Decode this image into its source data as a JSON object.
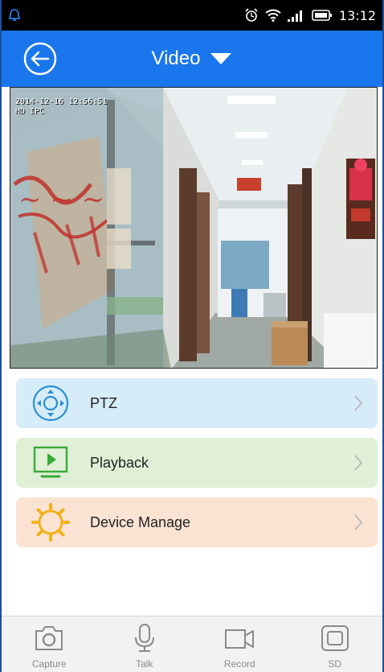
{
  "status_bar": {
    "time": "13:12",
    "icons": [
      "qq-bell-icon",
      "alarm-clock-icon",
      "wifi-icon",
      "signal-icon",
      "battery-icon"
    ]
  },
  "header": {
    "title": "Video",
    "back_icon": "back-arrow-icon",
    "dropdown_icon": "triangle-down-icon",
    "background_color": "#1a76ec"
  },
  "video": {
    "osd_datetime": "2014-12-16 12:56:51",
    "osd_camera": "HD IPC"
  },
  "menu": {
    "items": [
      {
        "label": "PTZ",
        "icon": "ptz-joystick-icon",
        "bg": "#d6ecf8"
      },
      {
        "label": "Playback",
        "icon": "playback-monitor-icon",
        "bg": "#dff0d6"
      },
      {
        "label": "Device Manage",
        "icon": "gear-icon",
        "bg": "#fbe3d4"
      }
    ]
  },
  "toolbar": {
    "items": [
      {
        "label": "Capture",
        "icon": "camera-icon"
      },
      {
        "label": "Talk",
        "icon": "microphone-icon"
      },
      {
        "label": "Record",
        "icon": "video-camera-icon"
      },
      {
        "label": "SD",
        "icon": "sd-card-icon"
      }
    ]
  }
}
